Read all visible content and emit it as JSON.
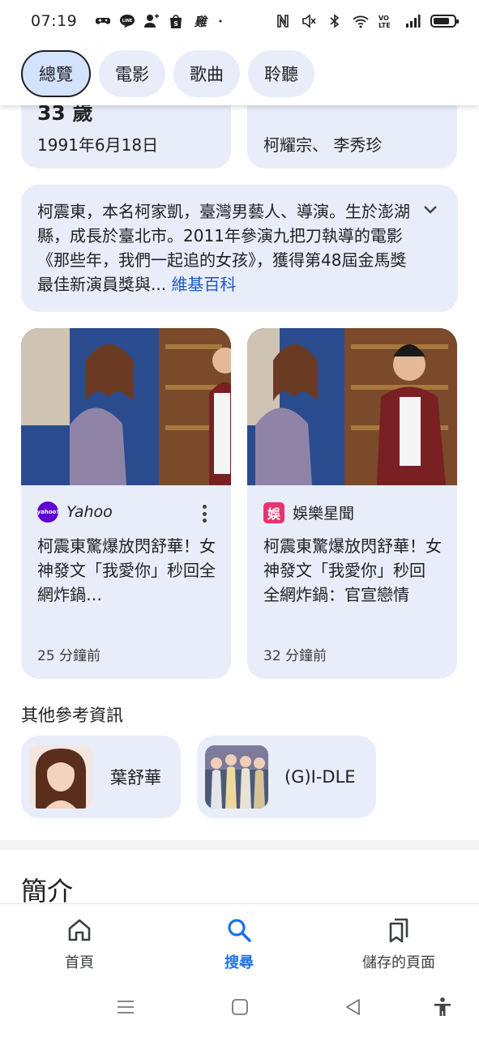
{
  "status_bar": {
    "time": "07:19",
    "left_icons": [
      "game-controller-icon",
      "line-app-icon",
      "add-contact-icon",
      "shopee-icon",
      "app-text-icon",
      "dot-icon"
    ],
    "right_icons": [
      "nfc-icon",
      "mute-icon",
      "bluetooth-icon",
      "wifi-icon",
      "volte-icon",
      "signal-icon",
      "battery-icon"
    ],
    "app_text": "雞",
    "battery_level": 0.8
  },
  "chips": [
    {
      "label": "總覽",
      "active": true
    },
    {
      "label": "電影",
      "active": false
    },
    {
      "label": "歌曲",
      "active": false
    },
    {
      "label": "聆聽",
      "active": false
    }
  ],
  "info_cards": [
    {
      "value": "33 歲",
      "sub": "1991年6月18日"
    },
    {
      "value": "",
      "sub": "柯耀宗、 李秀珍"
    }
  ],
  "bio": {
    "text": "柯震東，本名柯家凱，臺灣男藝人、導演。生於澎湖縣，成長於臺北市。2011年參演九把刀執導的電影《那些年，我們一起追的女孩》，獲得第48屆金馬獎最佳新演員獎與",
    "ellipsis": "...",
    "source_link": "維基百科"
  },
  "news": [
    {
      "source": "Yahoo",
      "logo_text": "yahoo!",
      "title": "柯震東驚爆放閃舒華！女神發文「我愛你」秒回全網炸鍋…",
      "time": "25 分鐘前"
    },
    {
      "source": "娛樂星聞",
      "logo_text": "娛",
      "title": "柯震東驚爆放閃舒華！女神發文「我愛你」秒回 全網炸鍋：官宣戀情",
      "time": "32 分鐘前"
    }
  ],
  "other_refs": {
    "heading": "其他參考資訊",
    "items": [
      {
        "name": "葉舒華"
      },
      {
        "name": "(G)I-DLE"
      }
    ]
  },
  "intro_heading": "簡介",
  "bottom_nav": [
    {
      "label": "首頁",
      "icon": "home-icon",
      "active": false
    },
    {
      "label": "搜尋",
      "icon": "search-icon",
      "active": true
    },
    {
      "label": "儲存的頁面",
      "icon": "bookmarks-icon",
      "active": false
    }
  ],
  "system_nav": [
    "menu-icon",
    "home-square-icon",
    "back-icon",
    "accessibility-icon"
  ],
  "colors": {
    "card_bg": "#e8edf9",
    "chip_active_bg": "#d3e3fd",
    "link_blue": "#1a58d0",
    "nav_active": "#1a73e8",
    "yahoo_purple": "#6001d2",
    "ent_pink": "#e8336d"
  }
}
